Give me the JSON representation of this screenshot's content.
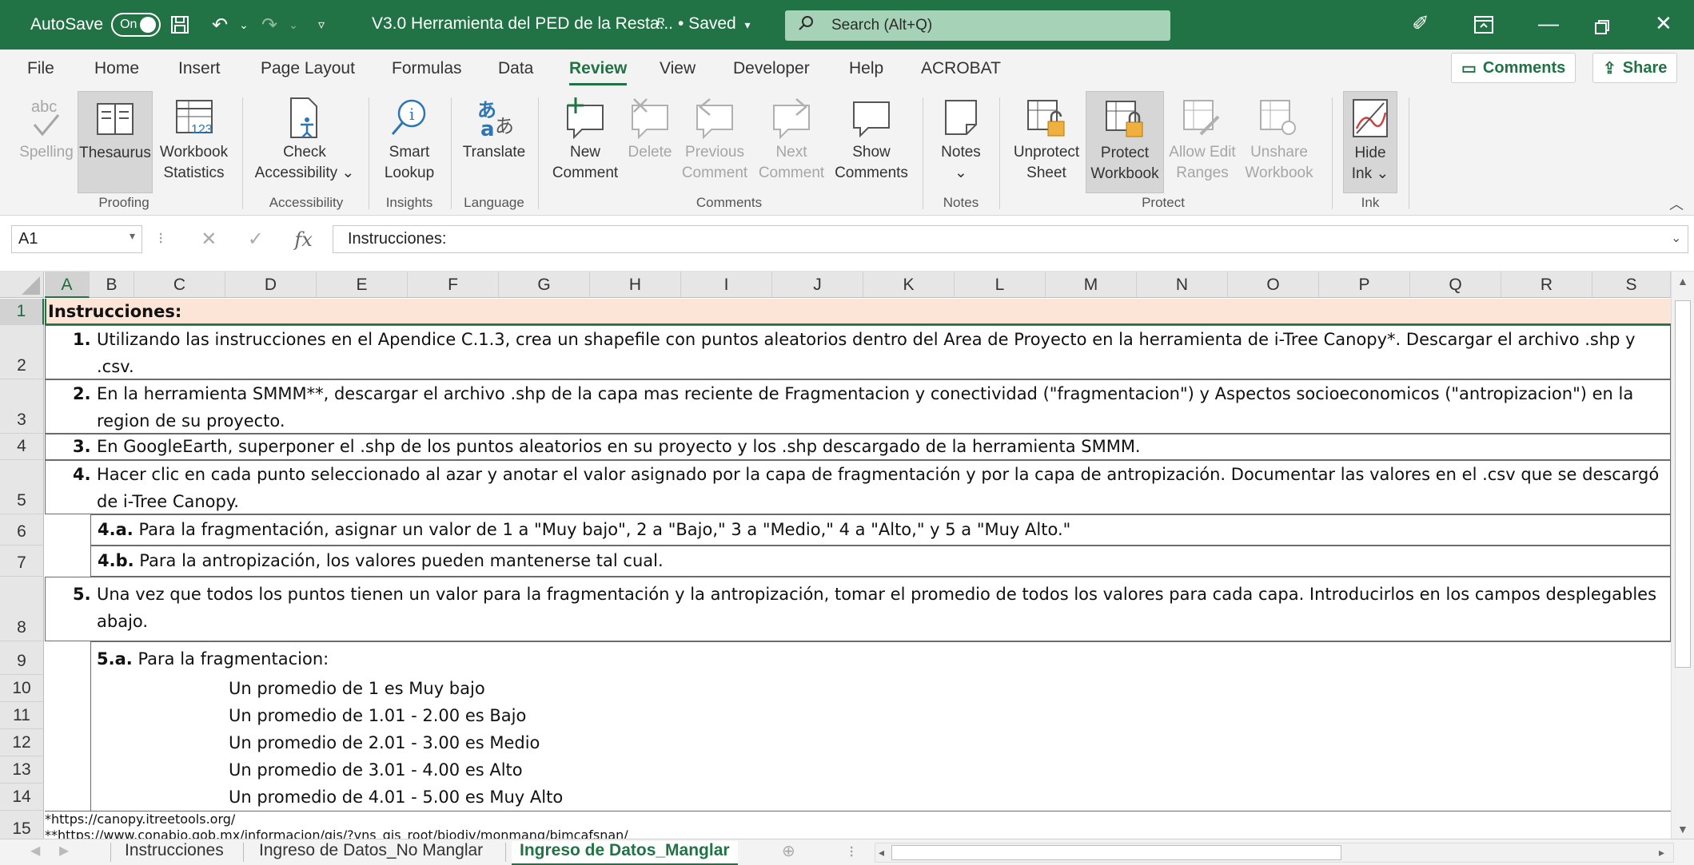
{
  "titlebar": {
    "autosave_label": "AutoSave",
    "autosave_state": "On",
    "title": "V3.0 Herramienta del PED de la Resta...",
    "saved": "• Saved",
    "search_placeholder": "Search (Alt+Q)"
  },
  "menu": {
    "tabs": [
      "File",
      "Home",
      "Insert",
      "Page Layout",
      "Formulas",
      "Data",
      "Review",
      "View",
      "Developer",
      "Help",
      "ACROBAT"
    ],
    "active": "Review",
    "comments_label": "Comments",
    "share_label": "Share"
  },
  "ribbon": {
    "buttons": [
      {
        "line1": "abc",
        "line2": "Spelling",
        "line3": ""
      },
      {
        "line1": "Thesaurus",
        "line2": ""
      },
      {
        "line1": "Workbook",
        "line2": "Statistics"
      },
      {
        "line1": "Check",
        "line2": "Accessibility ⌄"
      },
      {
        "line1": "Smart",
        "line2": "Lookup"
      },
      {
        "line1": "Translate",
        "line2": ""
      },
      {
        "line1": "New",
        "line2": "Comment"
      },
      {
        "line1": "Delete",
        "line2": ""
      },
      {
        "line1": "Previous",
        "line2": "Comment"
      },
      {
        "line1": "Next",
        "line2": "Comment"
      },
      {
        "line1": "Show",
        "line2": "Comments"
      },
      {
        "line1": "Notes",
        "line2": "⌄"
      },
      {
        "line1": "Unprotect",
        "line2": "Sheet"
      },
      {
        "line1": "Protect",
        "line2": "Workbook"
      },
      {
        "line1": "Allow Edit",
        "line2": "Ranges"
      },
      {
        "line1": "Unshare",
        "line2": "Workbook"
      },
      {
        "line1": "Hide",
        "line2": "Ink ⌄"
      }
    ],
    "groups": [
      "Proofing",
      "Accessibility",
      "Insights",
      "Language",
      "Comments",
      "Notes",
      "Protect",
      "Ink"
    ]
  },
  "formula_bar": {
    "name_box": "A1",
    "formula": "Instrucciones:"
  },
  "columns": [
    "A",
    "B",
    "C",
    "D",
    "E",
    "F",
    "G",
    "H",
    "I",
    "J",
    "K",
    "L",
    "M",
    "N",
    "O",
    "P",
    "Q",
    "R",
    "S"
  ],
  "rows": [
    "1",
    "2",
    "3",
    "4",
    "5",
    "6",
    "7",
    "8",
    "9",
    "10",
    "11",
    "12",
    "13",
    "14",
    "15"
  ],
  "cells": {
    "r1": "Instrucciones:",
    "r2_num": "1.",
    "r2_text": "Utilizando las instrucciones en el Apendice C.1.3, crea un shapefile con puntos aleatorios dentro del Area de Proyecto en la herramienta de i-Tree Canopy*. Descargar el archivo .shp y .csv.",
    "r3_num": "2.",
    "r3_text": "En la herramienta SMMM**, descargar el archivo .shp de la capa mas reciente de Fragmentacion y conectividad (\"fragmentacion\") y Aspectos socioeconomicos (\"antropizacion\") en la region de su proyecto.",
    "r4_num": "3.",
    "r4_text": "En GoogleEarth, superponer el .shp de los puntos aleatorios en su proyecto y los .shp descargado de la herramienta SMMM.",
    "r5_num": "4.",
    "r5_text": "Hacer clic en cada punto seleccionado al azar y anotar el valor asignado por la capa de fragmentación y por la capa de antropización.  Documentar las valores en el .csv que se descargó de i-Tree Canopy.",
    "r6_num": "4.a.",
    "r6_text": "Para la fragmentación, asignar un valor de 1 a \"Muy bajo\", 2 a \"Bajo,\" 3 a \"Medio,\" 4 a \"Alto,\" y 5 a \"Muy Alto.\"",
    "r7_num": "4.b.",
    "r7_text": "Para la antropización, los valores pueden mantenerse tal cual.",
    "r8_num": "5.",
    "r8_text": "Una vez que todos los puntos tienen un valor para la fragmentación y la antropización, tomar el promedio de todos los valores para cada capa. Introducirlos en los campos desplegables abajo.",
    "r9_num": "5.a.",
    "r9_text": "Para la fragmentacion:",
    "r10": "Un promedio de 1 es Muy bajo",
    "r11": "Un promedio de 1.01 - 2.00 es Bajo",
    "r12": "Un promedio de 2.01 - 3.00 es Medio",
    "r13": "Un promedio de 3.01 - 4.00 es Alto",
    "r14": "Un promedio de 4.01 - 5.00 es Muy Alto",
    "r15a": "*https://canopy.itreetools.org/",
    "r15b": "**https://www.conabio.gob.mx/informacion/gis/?vns_gis_root/biodiv/monmang/bimcafsnan/"
  },
  "sheets": {
    "tabs": [
      "Instrucciones",
      "Ingreso de Datos_No Manglar",
      "Ingreso de Datos_Manglar"
    ],
    "active": "Ingreso de Datos_Manglar"
  },
  "colors": {
    "accent": "#217346",
    "highlight_row": "#fce4d6"
  }
}
